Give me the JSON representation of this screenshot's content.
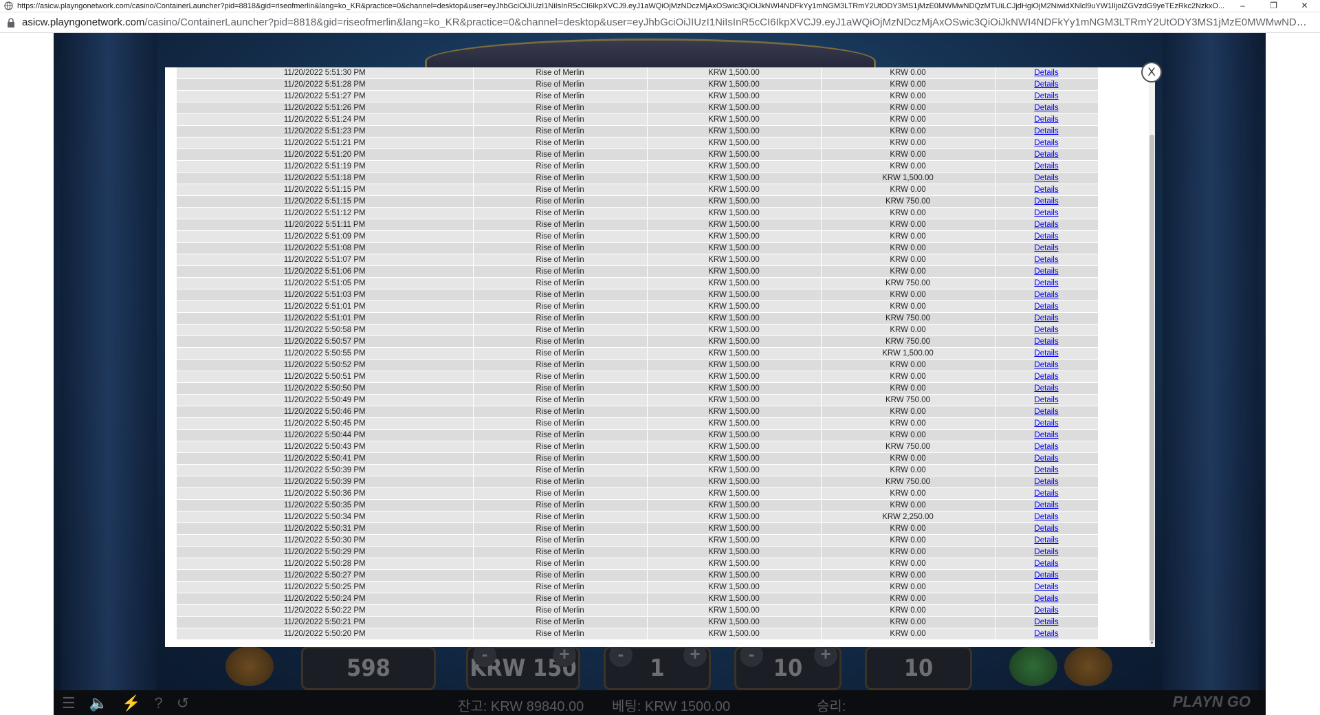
{
  "browser": {
    "title": "https://asicw.playngonetwork.com/casino/ContainerLauncher?pid=8818&gid=riseofmerlin&lang=ko_KR&practice=0&channel=desktop&user=eyJhbGciOiJIUzI1NiIsInR5cCI6IkpXVCJ9.eyJ1aWQiOjMzNDczMjAxOSwic3QiOiJkNWI4NDFkYy1mNGM3LTRmY2UtODY3MS1jMzE0MWMwNDQzMTUiLCJjdHgiOjM2NiwidXNlcl9uYW1lIjoiZGVzdG9yeTEzRkc2NzkxO...",
    "url_domain": "asicw.playngonetwork.com",
    "url_path": "/casino/ContainerLauncher?pid=8818&gid=riseofmerlin&lang=ko_KR&practice=0&channel=desktop&user=eyJhbGciOiJIUzI1NiIsInR5cCI6IkpXVCJ9.eyJ1aWQiOjMzNDczMjAxOSwic3QiOiJkNWI4NDFkYy1mNGM3LTRmY2UtODY3MS1jMzE0MWMwNDQzMTUiLCJjdHgiOjM2NiwidXNlcl9uYW1lIjoiZGVzdG9yeTEzRkc2NzkxO...",
    "minimize": "–",
    "restore": "❐",
    "close": "✕"
  },
  "modal": {
    "close_label": "X",
    "rows": [
      [
        "11/20/2022 5:51:30 PM",
        "Rise of Merlin",
        "KRW 1,500.00",
        "KRW 0.00",
        "Details"
      ],
      [
        "11/20/2022 5:51:28 PM",
        "Rise of Merlin",
        "KRW 1,500.00",
        "KRW 0.00",
        "Details"
      ],
      [
        "11/20/2022 5:51:27 PM",
        "Rise of Merlin",
        "KRW 1,500.00",
        "KRW 0.00",
        "Details"
      ],
      [
        "11/20/2022 5:51:26 PM",
        "Rise of Merlin",
        "KRW 1,500.00",
        "KRW 0.00",
        "Details"
      ],
      [
        "11/20/2022 5:51:24 PM",
        "Rise of Merlin",
        "KRW 1,500.00",
        "KRW 0.00",
        "Details"
      ],
      [
        "11/20/2022 5:51:23 PM",
        "Rise of Merlin",
        "KRW 1,500.00",
        "KRW 0.00",
        "Details"
      ],
      [
        "11/20/2022 5:51:21 PM",
        "Rise of Merlin",
        "KRW 1,500.00",
        "KRW 0.00",
        "Details"
      ],
      [
        "11/20/2022 5:51:20 PM",
        "Rise of Merlin",
        "KRW 1,500.00",
        "KRW 0.00",
        "Details"
      ],
      [
        "11/20/2022 5:51:19 PM",
        "Rise of Merlin",
        "KRW 1,500.00",
        "KRW 0.00",
        "Details"
      ],
      [
        "11/20/2022 5:51:18 PM",
        "Rise of Merlin",
        "KRW 1,500.00",
        "KRW 1,500.00",
        "Details"
      ],
      [
        "11/20/2022 5:51:15 PM",
        "Rise of Merlin",
        "KRW 1,500.00",
        "KRW 0.00",
        "Details"
      ],
      [
        "11/20/2022 5:51:15 PM",
        "Rise of Merlin",
        "KRW 1,500.00",
        "KRW 750.00",
        "Details"
      ],
      [
        "11/20/2022 5:51:12 PM",
        "Rise of Merlin",
        "KRW 1,500.00",
        "KRW 0.00",
        "Details"
      ],
      [
        "11/20/2022 5:51:11 PM",
        "Rise of Merlin",
        "KRW 1,500.00",
        "KRW 0.00",
        "Details"
      ],
      [
        "11/20/2022 5:51:09 PM",
        "Rise of Merlin",
        "KRW 1,500.00",
        "KRW 0.00",
        "Details"
      ],
      [
        "11/20/2022 5:51:08 PM",
        "Rise of Merlin",
        "KRW 1,500.00",
        "KRW 0.00",
        "Details"
      ],
      [
        "11/20/2022 5:51:07 PM",
        "Rise of Merlin",
        "KRW 1,500.00",
        "KRW 0.00",
        "Details"
      ],
      [
        "11/20/2022 5:51:06 PM",
        "Rise of Merlin",
        "KRW 1,500.00",
        "KRW 0.00",
        "Details"
      ],
      [
        "11/20/2022 5:51:05 PM",
        "Rise of Merlin",
        "KRW 1,500.00",
        "KRW 750.00",
        "Details"
      ],
      [
        "11/20/2022 5:51:03 PM",
        "Rise of Merlin",
        "KRW 1,500.00",
        "KRW 0.00",
        "Details"
      ],
      [
        "11/20/2022 5:51:01 PM",
        "Rise of Merlin",
        "KRW 1,500.00",
        "KRW 0.00",
        "Details"
      ],
      [
        "11/20/2022 5:51:01 PM",
        "Rise of Merlin",
        "KRW 1,500.00",
        "KRW 750.00",
        "Details"
      ],
      [
        "11/20/2022 5:50:58 PM",
        "Rise of Merlin",
        "KRW 1,500.00",
        "KRW 0.00",
        "Details"
      ],
      [
        "11/20/2022 5:50:57 PM",
        "Rise of Merlin",
        "KRW 1,500.00",
        "KRW 750.00",
        "Details"
      ],
      [
        "11/20/2022 5:50:55 PM",
        "Rise of Merlin",
        "KRW 1,500.00",
        "KRW 1,500.00",
        "Details"
      ],
      [
        "11/20/2022 5:50:52 PM",
        "Rise of Merlin",
        "KRW 1,500.00",
        "KRW 0.00",
        "Details"
      ],
      [
        "11/20/2022 5:50:51 PM",
        "Rise of Merlin",
        "KRW 1,500.00",
        "KRW 0.00",
        "Details"
      ],
      [
        "11/20/2022 5:50:50 PM",
        "Rise of Merlin",
        "KRW 1,500.00",
        "KRW 0.00",
        "Details"
      ],
      [
        "11/20/2022 5:50:49 PM",
        "Rise of Merlin",
        "KRW 1,500.00",
        "KRW 750.00",
        "Details"
      ],
      [
        "11/20/2022 5:50:46 PM",
        "Rise of Merlin",
        "KRW 1,500.00",
        "KRW 0.00",
        "Details"
      ],
      [
        "11/20/2022 5:50:45 PM",
        "Rise of Merlin",
        "KRW 1,500.00",
        "KRW 0.00",
        "Details"
      ],
      [
        "11/20/2022 5:50:44 PM",
        "Rise of Merlin",
        "KRW 1,500.00",
        "KRW 0.00",
        "Details"
      ],
      [
        "11/20/2022 5:50:43 PM",
        "Rise of Merlin",
        "KRW 1,500.00",
        "KRW 750.00",
        "Details"
      ],
      [
        "11/20/2022 5:50:41 PM",
        "Rise of Merlin",
        "KRW 1,500.00",
        "KRW 0.00",
        "Details"
      ],
      [
        "11/20/2022 5:50:39 PM",
        "Rise of Merlin",
        "KRW 1,500.00",
        "KRW 0.00",
        "Details"
      ],
      [
        "11/20/2022 5:50:39 PM",
        "Rise of Merlin",
        "KRW 1,500.00",
        "KRW 750.00",
        "Details"
      ],
      [
        "11/20/2022 5:50:36 PM",
        "Rise of Merlin",
        "KRW 1,500.00",
        "KRW 0.00",
        "Details"
      ],
      [
        "11/20/2022 5:50:35 PM",
        "Rise of Merlin",
        "KRW 1,500.00",
        "KRW 0.00",
        "Details"
      ],
      [
        "11/20/2022 5:50:34 PM",
        "Rise of Merlin",
        "KRW 1,500.00",
        "KRW 2,250.00",
        "Details"
      ],
      [
        "11/20/2022 5:50:31 PM",
        "Rise of Merlin",
        "KRW 1,500.00",
        "KRW 0.00",
        "Details"
      ],
      [
        "11/20/2022 5:50:30 PM",
        "Rise of Merlin",
        "KRW 1,500.00",
        "KRW 0.00",
        "Details"
      ],
      [
        "11/20/2022 5:50:29 PM",
        "Rise of Merlin",
        "KRW 1,500.00",
        "KRW 0.00",
        "Details"
      ],
      [
        "11/20/2022 5:50:28 PM",
        "Rise of Merlin",
        "KRW 1,500.00",
        "KRW 0.00",
        "Details"
      ],
      [
        "11/20/2022 5:50:27 PM",
        "Rise of Merlin",
        "KRW 1,500.00",
        "KRW 0.00",
        "Details"
      ],
      [
        "11/20/2022 5:50:25 PM",
        "Rise of Merlin",
        "KRW 1,500.00",
        "KRW 0.00",
        "Details"
      ],
      [
        "11/20/2022 5:50:24 PM",
        "Rise of Merlin",
        "KRW 1,500.00",
        "KRW 0.00",
        "Details"
      ],
      [
        "11/20/2022 5:50:22 PM",
        "Rise of Merlin",
        "KRW 1,500.00",
        "KRW 0.00",
        "Details"
      ],
      [
        "11/20/2022 5:50:21 PM",
        "Rise of Merlin",
        "KRW 1,500.00",
        "KRW 0.00",
        "Details"
      ],
      [
        "11/20/2022 5:50:20 PM",
        "Rise of Merlin",
        "KRW 1,500.00",
        "KRW 0.00",
        "Details"
      ]
    ]
  },
  "controls": {
    "lines": "598",
    "bet": "KRW 150",
    "level": "1",
    "coin_value": "10",
    "coins": "10",
    "plus": "+",
    "minus": "-"
  },
  "status": {
    "balance": "잔고: KRW 89840.00",
    "bet": "베팅: KRW 1500.00",
    "win": "승리:",
    "logo": "PLAYN GO",
    "icons": [
      "menu-icon",
      "sound-icon",
      "turbo-icon",
      "help-icon",
      "history-icon"
    ]
  },
  "colors": {
    "link": "#0000ee",
    "row_bg": "#e6e6e6",
    "game_bg": "#173455"
  }
}
